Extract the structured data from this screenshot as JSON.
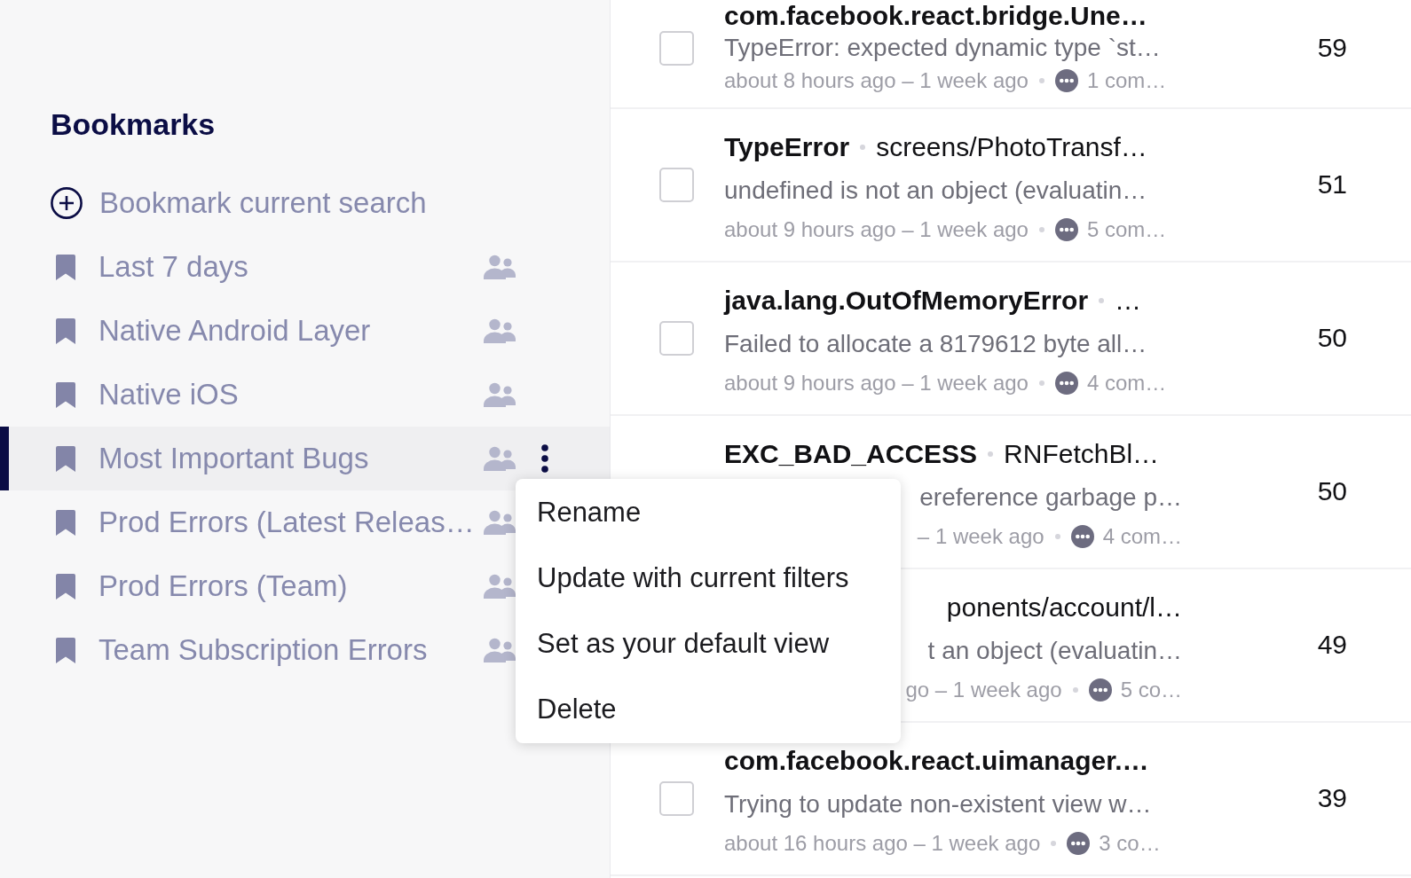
{
  "sidebar": {
    "title": "Bookmarks",
    "items": [
      {
        "kind": "action",
        "label": "Bookmark current search",
        "selected": false,
        "shared": false
      },
      {
        "kind": "bookmark",
        "label": "Last 7 days",
        "selected": false,
        "shared": true
      },
      {
        "kind": "bookmark",
        "label": "Native Android Layer",
        "selected": false,
        "shared": true
      },
      {
        "kind": "bookmark",
        "label": "Native iOS",
        "selected": false,
        "shared": true
      },
      {
        "kind": "bookmark",
        "label": "Most Important Bugs",
        "selected": true,
        "shared": true
      },
      {
        "kind": "bookmark",
        "label": "Prod Errors (Latest Releas…",
        "selected": false,
        "shared": true
      },
      {
        "kind": "bookmark",
        "label": "Prod Errors (Team)",
        "selected": false,
        "shared": true
      },
      {
        "kind": "bookmark",
        "label": "Team Subscription Errors",
        "selected": false,
        "shared": true
      }
    ]
  },
  "context_menu": {
    "open": true,
    "items": [
      "Rename",
      "Update with current filters",
      "Set as your default view",
      "Delete"
    ]
  },
  "issues": [
    {
      "checked": false,
      "covered": false,
      "error": "com.facebook.react.bridge.Une…",
      "message": "TypeError: expected dynamic type `st…",
      "time": "about 8 hours ago – 1 week ago",
      "comments": "1 com…",
      "count": "59"
    },
    {
      "checked": false,
      "covered": false,
      "error": "TypeError",
      "location": "screens/PhotoTransf…",
      "message": "undefined is not an object (evaluatin…",
      "time": "about 9 hours ago – 1 week ago",
      "comments": "5 com…",
      "count": "51"
    },
    {
      "checked": false,
      "covered": false,
      "error": "java.lang.OutOfMemoryError",
      "location": "…",
      "message": "Failed to allocate a 8179612 byte all…",
      "time": "about 9 hours ago – 1 week ago",
      "comments": "4 com…",
      "count": "50"
    },
    {
      "covered": true,
      "error": "EXC_BAD_ACCESS",
      "location": "RNFetchBl…",
      "message": "ereference garbage p…",
      "time": "– 1 week ago",
      "comments": "4 com…",
      "count": "50"
    },
    {
      "covered": true,
      "location": "ponents/account/l…",
      "message": "t an object (evaluatin…",
      "time": "go – 1 week ago",
      "comments": "5 co…",
      "count": "49"
    },
    {
      "checked": false,
      "covered": false,
      "error": "com.facebook.react.uimanager.…",
      "message": "Trying to update non-existent view w…",
      "time": "about 16 hours ago – 1 week ago",
      "comments": "3 co…",
      "count": "39"
    }
  ]
}
